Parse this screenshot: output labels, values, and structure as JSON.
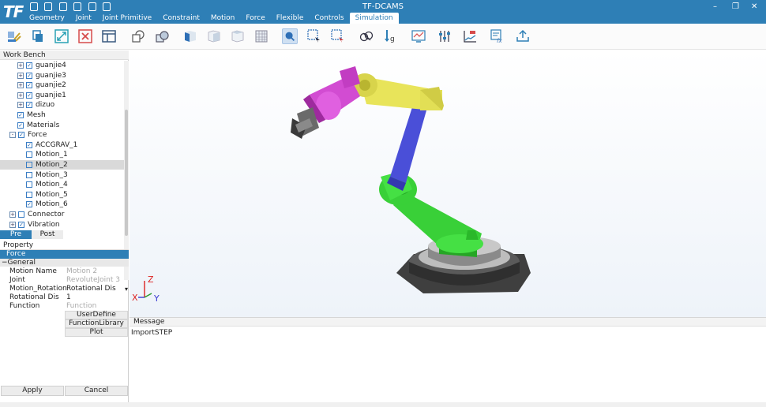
{
  "app": {
    "logo": "TF",
    "title": "TF-DCAMS"
  },
  "menu_tabs": [
    {
      "label": "Geometry"
    },
    {
      "label": "Joint"
    },
    {
      "label": "Joint Primitive"
    },
    {
      "label": "Constraint"
    },
    {
      "label": "Motion"
    },
    {
      "label": "Force"
    },
    {
      "label": "Flexible"
    },
    {
      "label": "Controls"
    },
    {
      "label": "Simulation"
    }
  ],
  "active_tab": "Simulation",
  "workbench": {
    "header": "Work Bench",
    "items": [
      {
        "label": "guanjie4",
        "expander": "+",
        "checked": true
      },
      {
        "label": "guanjie3",
        "expander": "+",
        "checked": true
      },
      {
        "label": "guanjie2",
        "expander": "+",
        "checked": true
      },
      {
        "label": "guanjie1",
        "expander": "+",
        "checked": true
      },
      {
        "label": "dizuo",
        "expander": "+",
        "checked": true
      },
      {
        "label": "Mesh",
        "checked": true
      },
      {
        "label": "Materials",
        "checked": true
      },
      {
        "label": "Force",
        "expander": "-",
        "checked": true
      },
      {
        "label": "ACCGRAV_1",
        "checked": true
      },
      {
        "label": "Motion_1",
        "checked": false
      },
      {
        "label": "Motion_2",
        "checked": false,
        "selected": true
      },
      {
        "label": "Motion_3",
        "checked": false
      },
      {
        "label": "Motion_4",
        "checked": false
      },
      {
        "label": "Motion_5",
        "checked": false
      },
      {
        "label": "Motion_6",
        "checked": true
      },
      {
        "label": "Connector",
        "expander": "+",
        "checked": false
      },
      {
        "label": "Vibration",
        "expander": "+",
        "checked": true
      }
    ]
  },
  "panel_tabs": [
    "Pre",
    "Post"
  ],
  "property": {
    "header": "Property",
    "section": "Force",
    "group": "General",
    "group_marker": "−",
    "rows": [
      {
        "key": "Motion Name",
        "value": "Motion 2"
      },
      {
        "key": "Joint",
        "value": "RevoluteJoint 3"
      },
      {
        "key": "Motion_Rotation",
        "value": "Rotational Dis",
        "dropdown_arrow": "▾"
      },
      {
        "key": "Rotational Dis",
        "value": "1"
      },
      {
        "key": "Function",
        "value": "Function"
      }
    ],
    "buttons": [
      "UserDefine",
      "FunctionLibrary",
      "Plot"
    ]
  },
  "actions": {
    "apply": "Apply",
    "cancel": "Cancel"
  },
  "message": {
    "header": "Message",
    "text": "ImportSTEP"
  },
  "axes": {
    "x": "X",
    "y": "Y",
    "z": "Z"
  },
  "window_controls": {
    "minimize": "–",
    "restore": "❐",
    "close": "✕"
  },
  "colors": {
    "accent": "#2e7fb6",
    "link_yellow": "#e8e45a",
    "link_magenta": "#d24cd2",
    "link_blue": "#4a4fd8",
    "link_green": "#39d038",
    "base_gray": "#5a5a5a"
  }
}
